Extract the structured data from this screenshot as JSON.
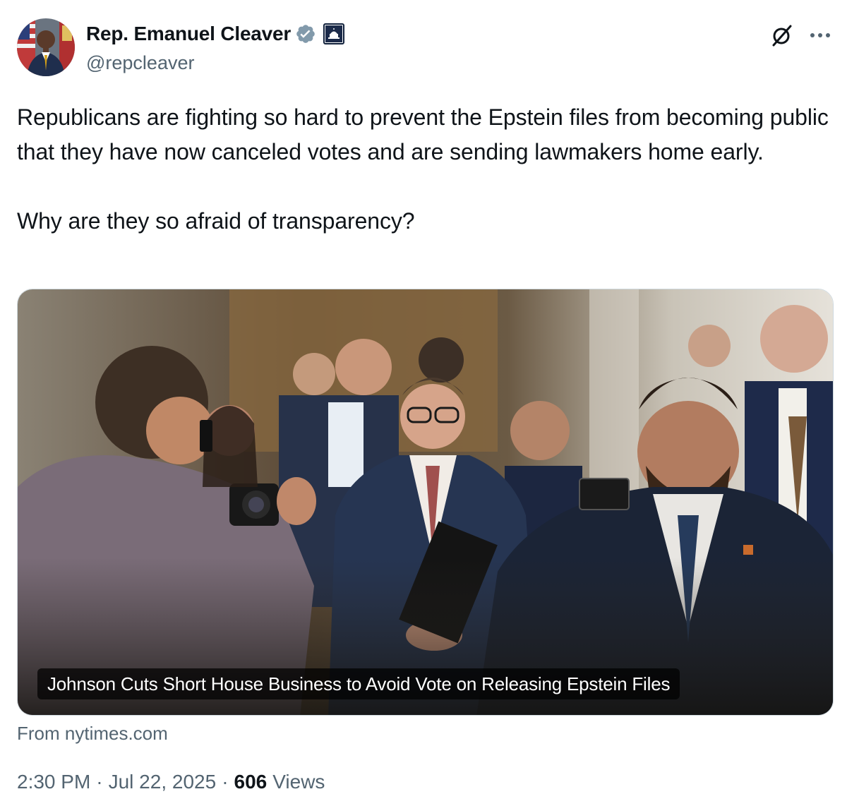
{
  "author": {
    "display_name": "Rep. Emanuel Cleaver",
    "handle": "@repcleaver",
    "verified_badge_color": "#829aab",
    "government_badge_icon": "capitol-building-icon"
  },
  "tweet": {
    "paragraph_1": "Republicans are fighting so hard to prevent the Epstein files from becoming public that they have now canceled votes and are sending lawmakers home early.",
    "paragraph_2": "Why are they so afraid of transparency?"
  },
  "link_card": {
    "title": "Johnson Cuts Short House Business to Avoid Vote on Releasing Epstein Files",
    "source": "From nytimes.com"
  },
  "meta": {
    "time": "2:30 PM",
    "separator": "·",
    "date": "Jul 22, 2025",
    "views_count": "606",
    "views_label": "Views"
  },
  "icons": {
    "grok": "grok-icon",
    "more": "more-options-icon"
  },
  "colors": {
    "text_primary": "#0f1419",
    "text_secondary": "#536471",
    "border": "#cfd9de"
  }
}
